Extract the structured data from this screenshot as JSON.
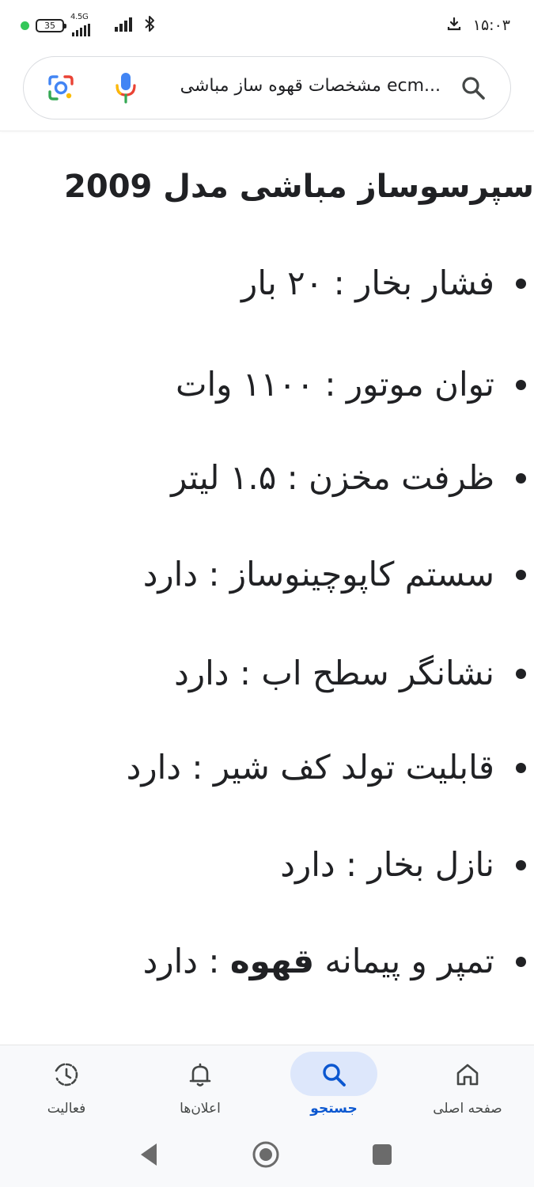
{
  "status_bar": {
    "battery_level": "35",
    "network_type": "4.5G",
    "time": "۱۵:۰۳",
    "indicator_color": "#34c759",
    "icons": [
      "green-dot",
      "battery-icon",
      "signal-icon",
      "signal-icon",
      "bluetooth-icon",
      "download-icon"
    ]
  },
  "search": {
    "query": "مشخصات قهوه ساز مباشی ecm...",
    "icons": [
      "google-lens-icon",
      "mic-icon",
      "search-icon"
    ]
  },
  "content": {
    "heading": "سپرسوساز مباشی مدل 2009",
    "specs": [
      {
        "text": "فشار بخار : ۲۰ بار"
      },
      {
        "text": "توان موتور : ۱۱۰۰ وات"
      },
      {
        "text": "ظرفت مخزن : ۱.۵ لیتر"
      },
      {
        "text": "سستم کاپوچینوساز : دارد"
      },
      {
        "text": "نشانگر سطح اب : دارد"
      },
      {
        "text": "قابلیت تولد کف شیر : دارد"
      },
      {
        "text": "نازل بخار : دارد"
      },
      {
        "before": "تمپر و پیمانه ",
        "bold": "قهوه",
        "after": " : دارد"
      }
    ]
  },
  "bottom_nav": {
    "items": [
      {
        "label": "صفحه اصلی",
        "icon": "home-icon",
        "active": false
      },
      {
        "label": "جستجو",
        "icon": "search-icon",
        "active": true
      },
      {
        "label": "اعلان‌ها",
        "icon": "bell-icon",
        "active": false
      },
      {
        "label": "فعالیت",
        "icon": "activity-icon",
        "active": false
      }
    ],
    "active_color": "#0b57d0"
  },
  "system_nav": {
    "icons": [
      "back-icon",
      "home-circle-icon",
      "recents-icon"
    ]
  }
}
